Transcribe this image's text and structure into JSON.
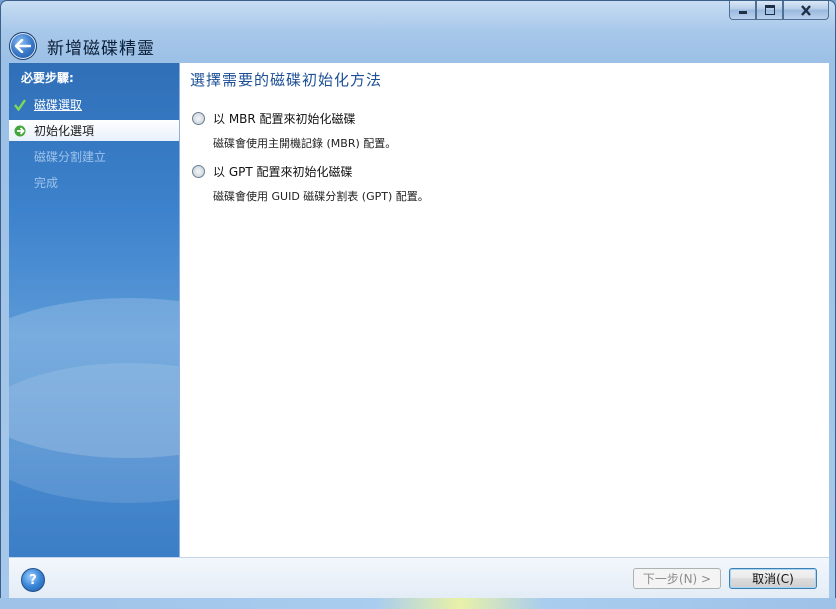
{
  "window": {
    "title": "新增磁碟精靈",
    "controls": [
      "minimize-icon",
      "maximize-icon",
      "close-icon"
    ]
  },
  "nav": {
    "header": "必要步驟:",
    "items": [
      {
        "label": "磁碟選取",
        "state": "done"
      },
      {
        "label": "初始化選項",
        "state": "active"
      },
      {
        "label": "磁碟分割建立",
        "state": "future"
      },
      {
        "label": "完成",
        "state": "future"
      }
    ]
  },
  "content": {
    "title": "選擇需要的磁碟初始化方法",
    "options": [
      {
        "label": "以 MBR 配置來初始化磁碟",
        "description": "磁碟會使用主開機記錄 (MBR) 配置。",
        "selected": false
      },
      {
        "label": "以 GPT 配置來初始化磁碟",
        "description": "磁碟會使用 GUID 磁碟分割表 (GPT) 配置。",
        "selected": false
      }
    ]
  },
  "footer": {
    "next_label": "下一步(N) >",
    "cancel_label": "取消(C)"
  },
  "colors": {
    "accent": "#1c4f95",
    "nav_bg": "#3d82cc"
  }
}
